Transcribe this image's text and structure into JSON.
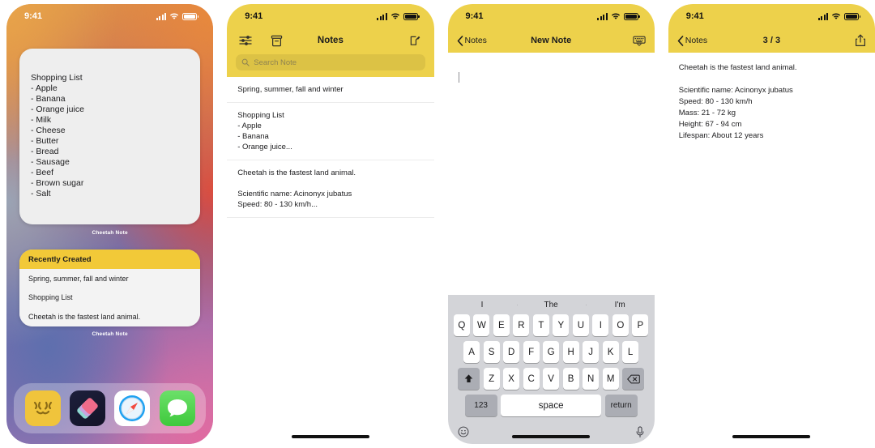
{
  "status_bar": {
    "time": "9:41"
  },
  "screen1": {
    "name": "home-screen",
    "widget_note": {
      "label": "Cheetah Note",
      "text": "Shopping List\n- Apple\n- Banana\n- Orange juice\n- Milk\n- Cheese\n- Butter\n- Bread\n- Sausage\n- Beef\n- Brown sugar\n- Salt"
    },
    "widget_recent": {
      "label": "Cheetah Note",
      "header": "Recently Created",
      "items": [
        "Spring, summer, fall and winter",
        "Shopping List",
        "Cheetah is the fastest land animal."
      ]
    },
    "dock": {
      "apps": [
        {
          "name": "notes-app-icon",
          "label": "Notes"
        },
        {
          "name": "shortcuts-app-icon",
          "label": "Shortcuts"
        },
        {
          "name": "safari-app-icon",
          "label": "Safari"
        },
        {
          "name": "messages-app-icon",
          "label": "Messages"
        }
      ]
    },
    "colors": {
      "widget_header": "#f2c938",
      "widget_body": "#f3f3f3"
    }
  },
  "screen2": {
    "name": "notes-list",
    "title": "Notes",
    "search_placeholder": "Search Note",
    "icons": {
      "filter": "sliders-icon",
      "archive": "archive-box-icon",
      "compose": "compose-icon"
    },
    "notes": [
      "Spring, summer, fall and winter",
      "Shopping List\n- Apple\n- Banana\n- Orange juice...",
      "Cheetah is the fastest land animal.\n\nScientific name: Acinonyx jubatus\nSpeed: 80 - 130 km/h..."
    ],
    "colors": {
      "header": "#edd14b"
    }
  },
  "screen3": {
    "name": "new-note-editor",
    "back_label": "Notes",
    "title": "New Note",
    "right_icon": "keyboard-dismiss-icon",
    "body": "",
    "keyboard": {
      "suggestions": [
        "I",
        "The",
        "I'm"
      ],
      "row1": [
        "Q",
        "W",
        "E",
        "R",
        "T",
        "Y",
        "U",
        "I",
        "O",
        "P"
      ],
      "row2": [
        "A",
        "S",
        "D",
        "F",
        "G",
        "H",
        "J",
        "K",
        "L"
      ],
      "row3": [
        "Z",
        "X",
        "C",
        "V",
        "B",
        "N",
        "M"
      ],
      "shift": "shift-icon",
      "backspace": "backspace-icon",
      "numbers_label": "123",
      "space_label": "space",
      "return_label": "return",
      "emoji": "emoji-icon",
      "mic": "microphone-icon"
    }
  },
  "screen4": {
    "name": "note-detail",
    "back_label": "Notes",
    "title": "3 / 3",
    "right_icon": "share-icon",
    "body": "Cheetah is the fastest land animal.\n\nScientific name: Acinonyx jubatus\nSpeed: 80 - 130 km/h\nMass: 21 - 72 kg\nHeight: 67 - 94 cm\nLifespan: About 12 years"
  }
}
